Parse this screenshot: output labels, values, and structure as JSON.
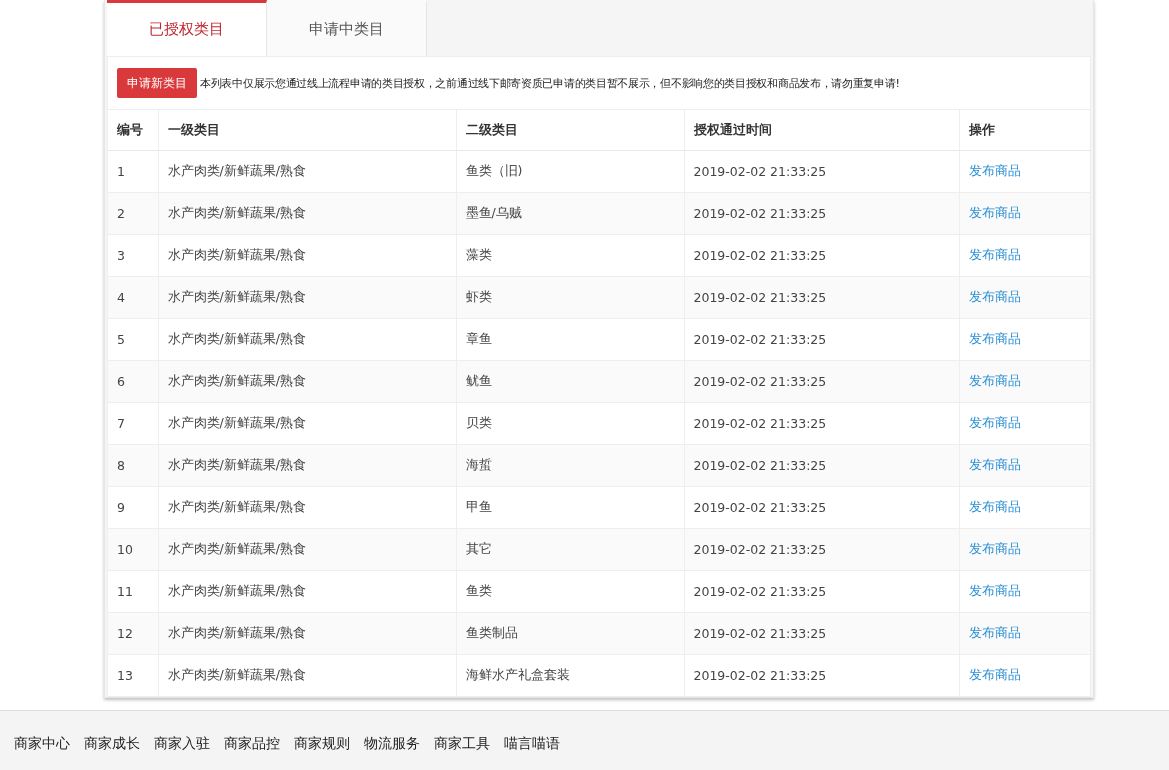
{
  "tabs": [
    {
      "label": "已授权类目",
      "selected": true
    },
    {
      "label": "申请中类目",
      "selected": false
    }
  ],
  "toolbar": {
    "button": "申请新类目",
    "notice": "本列表中仅展示您通过线上流程申请的类目授权，之前通过线下邮寄资质已申请的类目暂不展示，但不影响您的类目授权和商品发布，请勿重复申请!"
  },
  "table": {
    "columns": [
      "编号",
      "一级类目",
      "二级类目",
      "授权通过时间",
      "操作"
    ],
    "rows": [
      {
        "no": "1",
        "level1": "水产肉类/新鲜蔬果/熟食",
        "level2": "鱼类（旧)",
        "time": "2019-02-02 21:33:25",
        "action": "发布商品"
      },
      {
        "no": "2",
        "level1": "水产肉类/新鲜蔬果/熟食",
        "level2": "墨鱼/乌贼",
        "time": "2019-02-02 21:33:25",
        "action": "发布商品"
      },
      {
        "no": "3",
        "level1": "水产肉类/新鲜蔬果/熟食",
        "level2": "藻类",
        "time": "2019-02-02 21:33:25",
        "action": "发布商品"
      },
      {
        "no": "4",
        "level1": "水产肉类/新鲜蔬果/熟食",
        "level2": "虾类",
        "time": "2019-02-02 21:33:25",
        "action": "发布商品"
      },
      {
        "no": "5",
        "level1": "水产肉类/新鲜蔬果/熟食",
        "level2": "章鱼",
        "time": "2019-02-02 21:33:25",
        "action": "发布商品"
      },
      {
        "no": "6",
        "level1": "水产肉类/新鲜蔬果/熟食",
        "level2": "鱿鱼",
        "time": "2019-02-02 21:33:25",
        "action": "发布商品"
      },
      {
        "no": "7",
        "level1": "水产肉类/新鲜蔬果/熟食",
        "level2": "贝类",
        "time": "2019-02-02 21:33:25",
        "action": "发布商品"
      },
      {
        "no": "8",
        "level1": "水产肉类/新鲜蔬果/熟食",
        "level2": "海蜇",
        "time": "2019-02-02 21:33:25",
        "action": "发布商品"
      },
      {
        "no": "9",
        "level1": "水产肉类/新鲜蔬果/熟食",
        "level2": "甲鱼",
        "time": "2019-02-02 21:33:25",
        "action": "发布商品"
      },
      {
        "no": "10",
        "level1": "水产肉类/新鲜蔬果/熟食",
        "level2": "其它",
        "time": "2019-02-02 21:33:25",
        "action": "发布商品"
      },
      {
        "no": "11",
        "level1": "水产肉类/新鲜蔬果/熟食",
        "level2": "鱼类",
        "time": "2019-02-02 21:33:25",
        "action": "发布商品"
      },
      {
        "no": "12",
        "level1": "水产肉类/新鲜蔬果/熟食",
        "level2": "鱼类制品",
        "time": "2019-02-02 21:33:25",
        "action": "发布商品"
      },
      {
        "no": "13",
        "level1": "水产肉类/新鲜蔬果/熟食",
        "level2": "海鲜水产礼盒套装",
        "time": "2019-02-02 21:33:25",
        "action": "发布商品"
      }
    ]
  },
  "footer": {
    "links": [
      "商家中心",
      "商家成长",
      "商家入驻",
      "商家品控",
      "商家规则",
      "物流服务",
      "商家工具",
      "喵言喵语"
    ]
  }
}
